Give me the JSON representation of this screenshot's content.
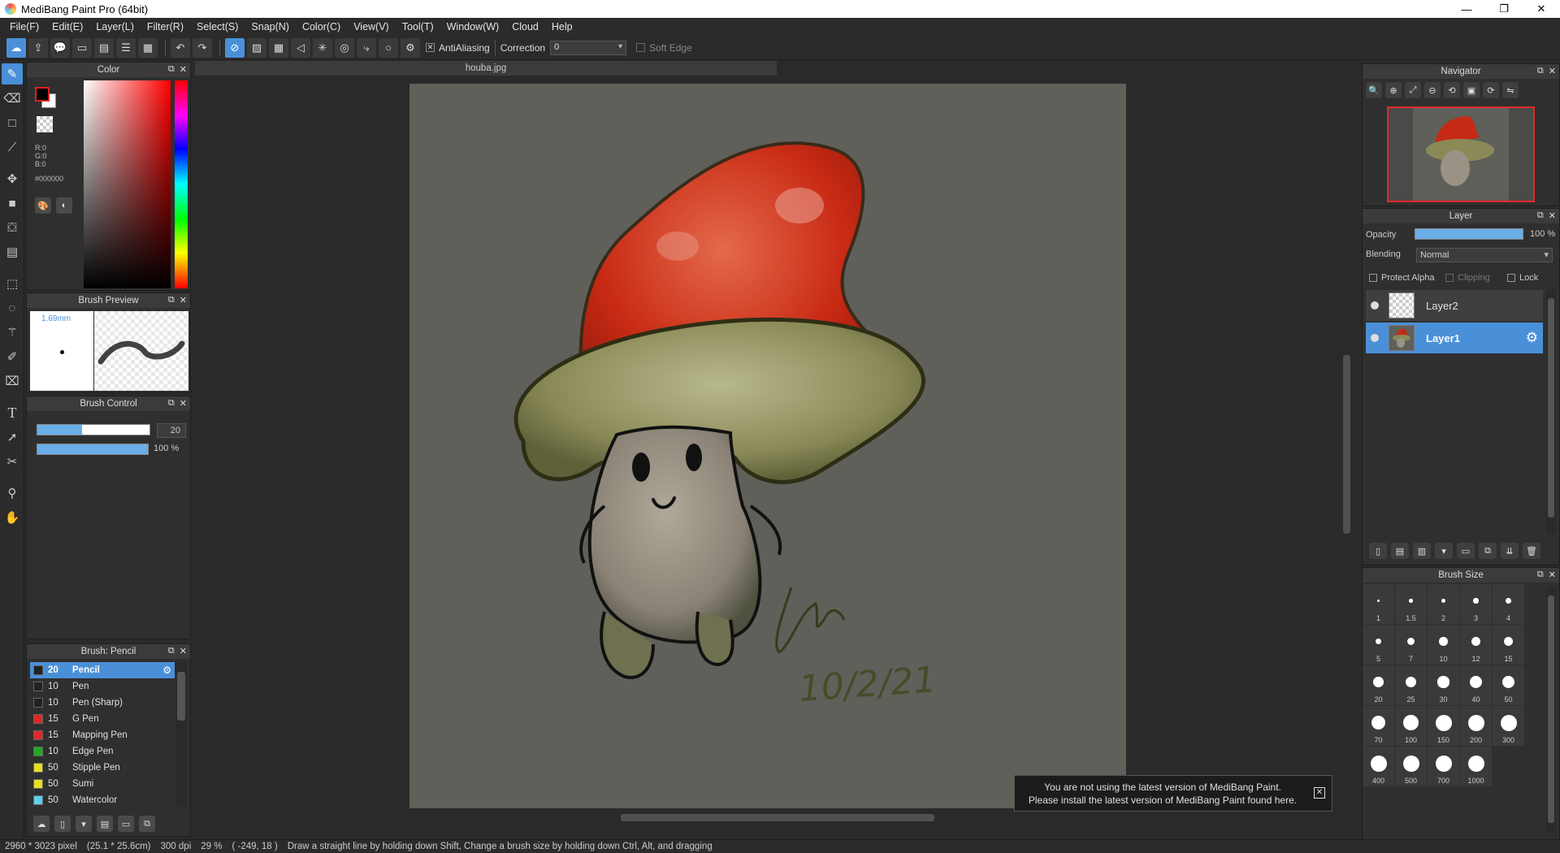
{
  "window": {
    "title": "MediBang Paint Pro (64bit)",
    "controls": [
      "—",
      "❐",
      "✕"
    ]
  },
  "menu": [
    "File(F)",
    "Edit(E)",
    "Layer(L)",
    "Filter(R)",
    "Select(S)",
    "Snap(N)",
    "Color(C)",
    "View(V)",
    "Tool(T)",
    "Window(W)",
    "Cloud",
    "Help"
  ],
  "toolbar": {
    "antialiasing_label": "AntiAliasing",
    "correction_label": "Correction",
    "correction_value": "0",
    "soft_edge_label": "Soft Edge"
  },
  "color_panel": {
    "title": "Color",
    "r": "R:0",
    "g": "G:0",
    "b": "B:0",
    "hex": "#000000",
    "foreground": "#000000",
    "background": "#ffffff"
  },
  "brush_preview": {
    "title": "Brush Preview",
    "size": "1.69mm"
  },
  "brush_control": {
    "title": "Brush Control",
    "size_value": "20",
    "size_fraction": 0.4,
    "opacity_value": "100 %",
    "opacity_fraction": 1.0
  },
  "brush_list": {
    "title": "Brush: Pencil",
    "items": [
      {
        "size": "20",
        "name": "Pencil",
        "color": "#222222",
        "selected": true
      },
      {
        "size": "10",
        "name": "Pen",
        "color": "#222222"
      },
      {
        "size": "10",
        "name": "Pen (Sharp)",
        "color": "#222222"
      },
      {
        "size": "15",
        "name": "G Pen",
        "color": "#e02828"
      },
      {
        "size": "15",
        "name": "Mapping Pen",
        "color": "#e02828"
      },
      {
        "size": "10",
        "name": "Edge Pen",
        "color": "#22aa22"
      },
      {
        "size": "50",
        "name": "Stipple Pen",
        "color": "#e6e020"
      },
      {
        "size": "50",
        "name": "Sumi",
        "color": "#e6e020"
      },
      {
        "size": "50",
        "name": "Watercolor",
        "color": "#60d0f0"
      }
    ]
  },
  "document": {
    "tab_name": "houba.jpg",
    "signature_date": "10/2/21"
  },
  "notice": {
    "line1": "You are not using the latest version of MediBang Paint.",
    "line2": "Please install the latest version of MediBang Paint found here."
  },
  "navigator": {
    "title": "Navigator"
  },
  "layer_panel": {
    "title": "Layer",
    "opacity_label": "Opacity",
    "opacity_value": "100 %",
    "opacity_fraction": 1.0,
    "blending_label": "Blending",
    "blending_value": "Normal",
    "protect_alpha": "Protect Alpha",
    "clipping": "Clipping",
    "lock": "Lock",
    "layers": [
      {
        "name": "Layer2",
        "selected": false
      },
      {
        "name": "Layer1",
        "selected": true
      }
    ]
  },
  "brush_size_panel": {
    "title": "Brush Size",
    "sizes": [
      "1",
      "1.5",
      "2",
      "3",
      "4",
      "5",
      "7",
      "10",
      "12",
      "15",
      "20",
      "25",
      "30",
      "40",
      "50",
      "70",
      "100",
      "150",
      "200",
      "300",
      "400",
      "500",
      "700",
      "1000"
    ]
  },
  "status": {
    "dimensions": "2960 * 3023 pixel",
    "physical": "(25.1 * 25.6cm)",
    "dpi": "300 dpi",
    "zoom": "29 %",
    "coords": "( -249, 18 )",
    "hint": "Draw a straight line by holding down Shift, Change a brush size by holding down Ctrl, Alt, and dragging"
  }
}
